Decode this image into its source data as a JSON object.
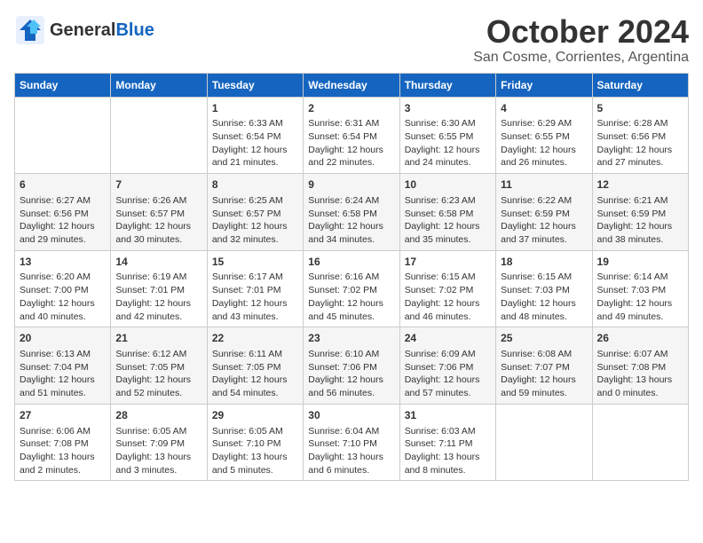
{
  "logo": {
    "general": "General",
    "blue": "Blue"
  },
  "title": "October 2024",
  "subtitle": "San Cosme, Corrientes, Argentina",
  "days_of_week": [
    "Sunday",
    "Monday",
    "Tuesday",
    "Wednesday",
    "Thursday",
    "Friday",
    "Saturday"
  ],
  "weeks": [
    [
      {
        "day": "",
        "info": ""
      },
      {
        "day": "",
        "info": ""
      },
      {
        "day": "1",
        "info": "Sunrise: 6:33 AM\nSunset: 6:54 PM\nDaylight: 12 hours and 21 minutes."
      },
      {
        "day": "2",
        "info": "Sunrise: 6:31 AM\nSunset: 6:54 PM\nDaylight: 12 hours and 22 minutes."
      },
      {
        "day": "3",
        "info": "Sunrise: 6:30 AM\nSunset: 6:55 PM\nDaylight: 12 hours and 24 minutes."
      },
      {
        "day": "4",
        "info": "Sunrise: 6:29 AM\nSunset: 6:55 PM\nDaylight: 12 hours and 26 minutes."
      },
      {
        "day": "5",
        "info": "Sunrise: 6:28 AM\nSunset: 6:56 PM\nDaylight: 12 hours and 27 minutes."
      }
    ],
    [
      {
        "day": "6",
        "info": "Sunrise: 6:27 AM\nSunset: 6:56 PM\nDaylight: 12 hours and 29 minutes."
      },
      {
        "day": "7",
        "info": "Sunrise: 6:26 AM\nSunset: 6:57 PM\nDaylight: 12 hours and 30 minutes."
      },
      {
        "day": "8",
        "info": "Sunrise: 6:25 AM\nSunset: 6:57 PM\nDaylight: 12 hours and 32 minutes."
      },
      {
        "day": "9",
        "info": "Sunrise: 6:24 AM\nSunset: 6:58 PM\nDaylight: 12 hours and 34 minutes."
      },
      {
        "day": "10",
        "info": "Sunrise: 6:23 AM\nSunset: 6:58 PM\nDaylight: 12 hours and 35 minutes."
      },
      {
        "day": "11",
        "info": "Sunrise: 6:22 AM\nSunset: 6:59 PM\nDaylight: 12 hours and 37 minutes."
      },
      {
        "day": "12",
        "info": "Sunrise: 6:21 AM\nSunset: 6:59 PM\nDaylight: 12 hours and 38 minutes."
      }
    ],
    [
      {
        "day": "13",
        "info": "Sunrise: 6:20 AM\nSunset: 7:00 PM\nDaylight: 12 hours and 40 minutes."
      },
      {
        "day": "14",
        "info": "Sunrise: 6:19 AM\nSunset: 7:01 PM\nDaylight: 12 hours and 42 minutes."
      },
      {
        "day": "15",
        "info": "Sunrise: 6:17 AM\nSunset: 7:01 PM\nDaylight: 12 hours and 43 minutes."
      },
      {
        "day": "16",
        "info": "Sunrise: 6:16 AM\nSunset: 7:02 PM\nDaylight: 12 hours and 45 minutes."
      },
      {
        "day": "17",
        "info": "Sunrise: 6:15 AM\nSunset: 7:02 PM\nDaylight: 12 hours and 46 minutes."
      },
      {
        "day": "18",
        "info": "Sunrise: 6:15 AM\nSunset: 7:03 PM\nDaylight: 12 hours and 48 minutes."
      },
      {
        "day": "19",
        "info": "Sunrise: 6:14 AM\nSunset: 7:03 PM\nDaylight: 12 hours and 49 minutes."
      }
    ],
    [
      {
        "day": "20",
        "info": "Sunrise: 6:13 AM\nSunset: 7:04 PM\nDaylight: 12 hours and 51 minutes."
      },
      {
        "day": "21",
        "info": "Sunrise: 6:12 AM\nSunset: 7:05 PM\nDaylight: 12 hours and 52 minutes."
      },
      {
        "day": "22",
        "info": "Sunrise: 6:11 AM\nSunset: 7:05 PM\nDaylight: 12 hours and 54 minutes."
      },
      {
        "day": "23",
        "info": "Sunrise: 6:10 AM\nSunset: 7:06 PM\nDaylight: 12 hours and 56 minutes."
      },
      {
        "day": "24",
        "info": "Sunrise: 6:09 AM\nSunset: 7:06 PM\nDaylight: 12 hours and 57 minutes."
      },
      {
        "day": "25",
        "info": "Sunrise: 6:08 AM\nSunset: 7:07 PM\nDaylight: 12 hours and 59 minutes."
      },
      {
        "day": "26",
        "info": "Sunrise: 6:07 AM\nSunset: 7:08 PM\nDaylight: 13 hours and 0 minutes."
      }
    ],
    [
      {
        "day": "27",
        "info": "Sunrise: 6:06 AM\nSunset: 7:08 PM\nDaylight: 13 hours and 2 minutes."
      },
      {
        "day": "28",
        "info": "Sunrise: 6:05 AM\nSunset: 7:09 PM\nDaylight: 13 hours and 3 minutes."
      },
      {
        "day": "29",
        "info": "Sunrise: 6:05 AM\nSunset: 7:10 PM\nDaylight: 13 hours and 5 minutes."
      },
      {
        "day": "30",
        "info": "Sunrise: 6:04 AM\nSunset: 7:10 PM\nDaylight: 13 hours and 6 minutes."
      },
      {
        "day": "31",
        "info": "Sunrise: 6:03 AM\nSunset: 7:11 PM\nDaylight: 13 hours and 8 minutes."
      },
      {
        "day": "",
        "info": ""
      },
      {
        "day": "",
        "info": ""
      }
    ]
  ]
}
